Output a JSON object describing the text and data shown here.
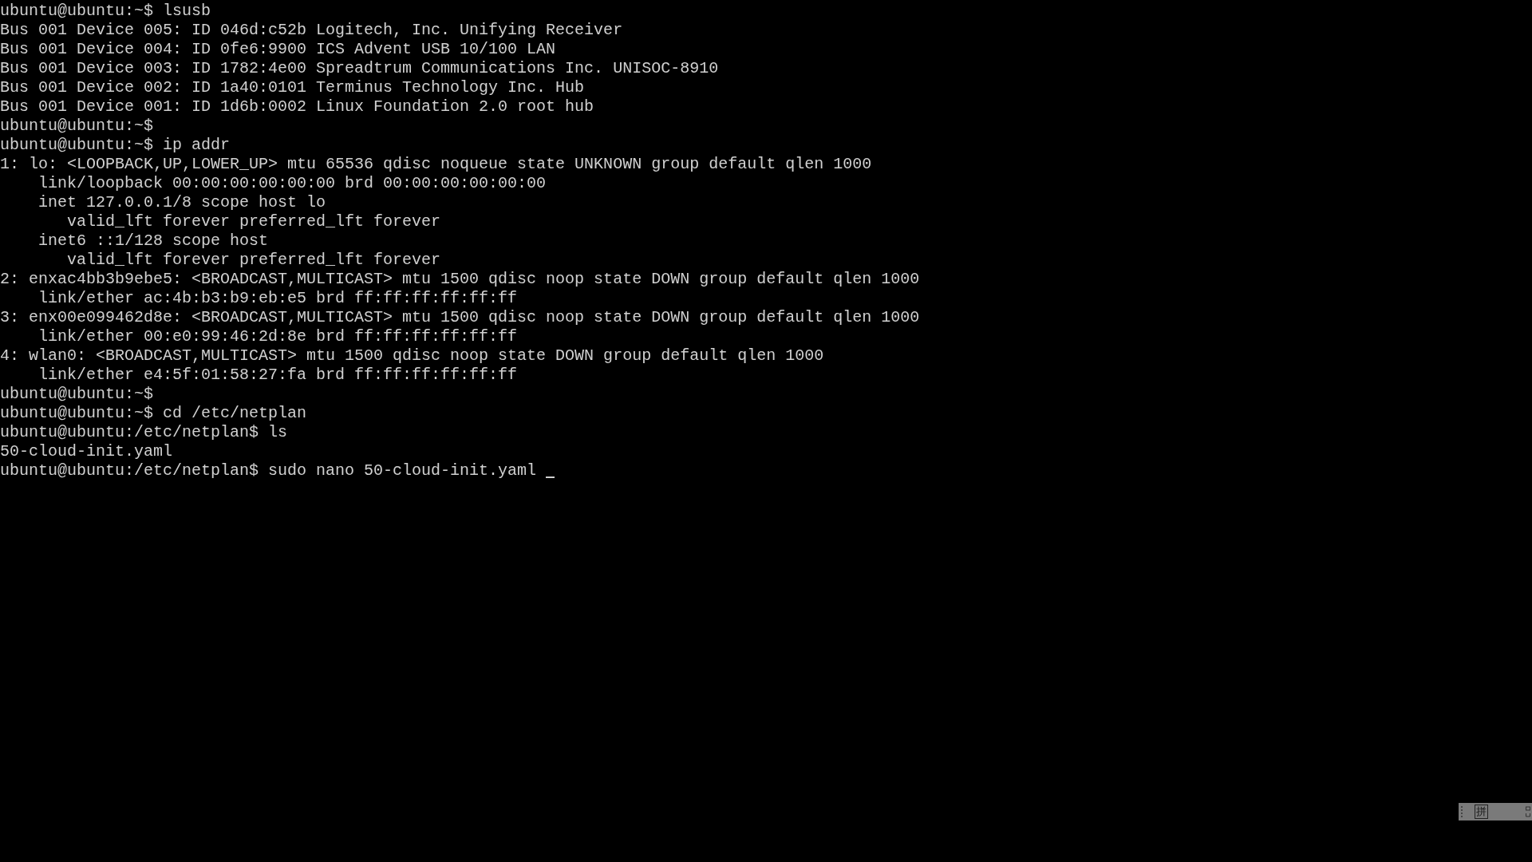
{
  "terminal": {
    "lines": [
      "ubuntu@ubuntu:~$ lsusb",
      "Bus 001 Device 005: ID 046d:c52b Logitech, Inc. Unifying Receiver",
      "Bus 001 Device 004: ID 0fe6:9900 ICS Advent USB 10/100 LAN",
      "Bus 001 Device 003: ID 1782:4e00 Spreadtrum Communications Inc. UNISOC-8910",
      "Bus 001 Device 002: ID 1a40:0101 Terminus Technology Inc. Hub",
      "Bus 001 Device 001: ID 1d6b:0002 Linux Foundation 2.0 root hub",
      "ubuntu@ubuntu:~$",
      "ubuntu@ubuntu:~$ ip addr",
      "1: lo: <LOOPBACK,UP,LOWER_UP> mtu 65536 qdisc noqueue state UNKNOWN group default qlen 1000",
      "    link/loopback 00:00:00:00:00:00 brd 00:00:00:00:00:00",
      "    inet 127.0.0.1/8 scope host lo",
      "       valid_lft forever preferred_lft forever",
      "    inet6 ::1/128 scope host",
      "       valid_lft forever preferred_lft forever",
      "2: enxac4bb3b9ebe5: <BROADCAST,MULTICAST> mtu 1500 qdisc noop state DOWN group default qlen 1000",
      "    link/ether ac:4b:b3:b9:eb:e5 brd ff:ff:ff:ff:ff:ff",
      "3: enx00e099462d8e: <BROADCAST,MULTICAST> mtu 1500 qdisc noop state DOWN group default qlen 1000",
      "    link/ether 00:e0:99:46:2d:8e brd ff:ff:ff:ff:ff:ff",
      "4: wlan0: <BROADCAST,MULTICAST> mtu 1500 qdisc noop state DOWN group default qlen 1000",
      "    link/ether e4:5f:01:58:27:fa brd ff:ff:ff:ff:ff:ff",
      "ubuntu@ubuntu:~$",
      "ubuntu@ubuntu:~$ cd /etc/netplan",
      "ubuntu@ubuntu:/etc/netplan$ ls",
      "50-cloud-init.yaml",
      "ubuntu@ubuntu:/etc/netplan$ sudo nano 50-cloud-init.yaml"
    ],
    "cursor": true
  },
  "ime_bar": {
    "mode_label": "拼"
  }
}
